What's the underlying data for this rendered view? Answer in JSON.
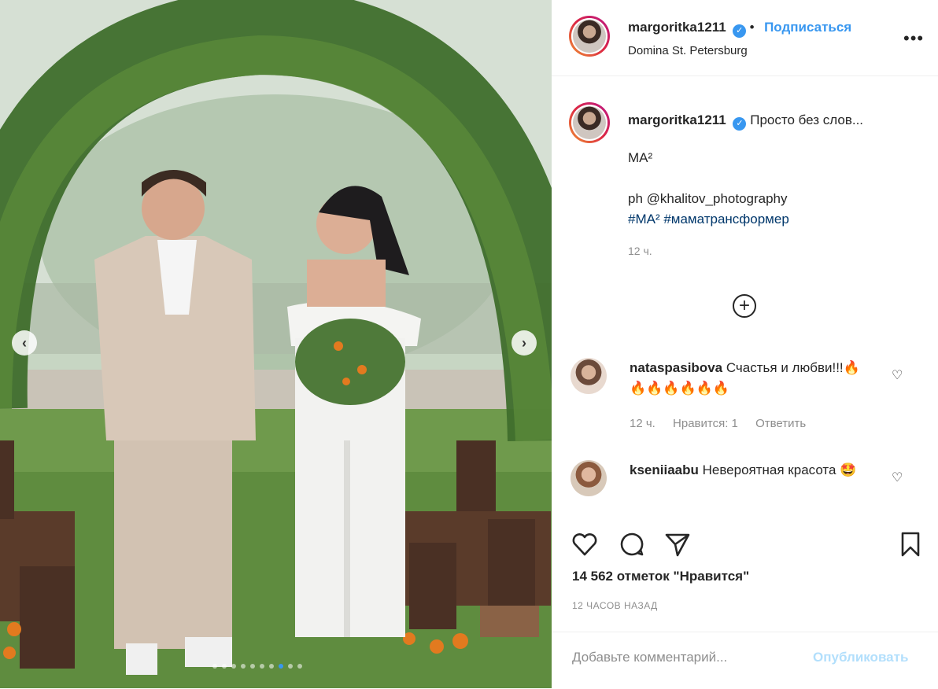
{
  "post": {
    "username": "margoritka1211",
    "follow_label": "Подписаться",
    "location": "Domina St. Petersburg",
    "more_icon": "more-horizontal-icon"
  },
  "caption": {
    "username": "margoritka1211",
    "text": "Просто без слов...",
    "line2": "МА²",
    "line3": "ph @khalitov_photography",
    "line4": "#МА² #маматрансформер",
    "time": "12 ч."
  },
  "comments": [
    {
      "username": "nataspasibova",
      "text": "Счастья и любви!!!🔥🔥🔥🔥🔥🔥🔥",
      "time": "12 ч.",
      "likes": "Нравится: 1",
      "reply": "Ответить"
    },
    {
      "username": "kseniiaabu",
      "text": "Невероятная красота 🤩"
    }
  ],
  "stats": {
    "likes": "14 562 отметок \"Нравится\"",
    "time": "12 ЧАСОВ НАЗАД"
  },
  "add_comment": {
    "placeholder": "Добавьте комментарий...",
    "post_label": "Опубликовать"
  },
  "carousel": {
    "prev_icon": "chevron-left-icon",
    "next_icon": "chevron-right-icon",
    "slides": 10,
    "active_slide": 8
  },
  "colors": {
    "accent": "#3897f0",
    "text": "#262626",
    "muted": "#8e8e8e",
    "link": "#00376b"
  }
}
